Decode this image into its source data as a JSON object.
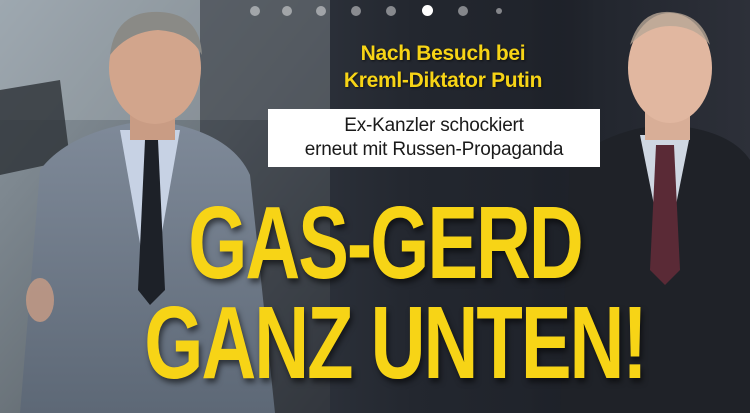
{
  "article": {
    "kicker_line1": "Nach Besuch bei",
    "kicker_line2": "Kreml-Diktator Putin",
    "subline_line1": "Ex-Kanzler schockiert",
    "subline_line2": "erneut mit Russen-Propaganda",
    "headline_line1": "GAS-GERD",
    "headline_line2": "GANZ UNTEN!"
  },
  "carousel": {
    "slide_count": 8,
    "active_index": 5
  },
  "colors": {
    "accent_yellow": "#f7d416",
    "subline_bg": "#ffffff",
    "subline_text": "#1a1a1a"
  }
}
